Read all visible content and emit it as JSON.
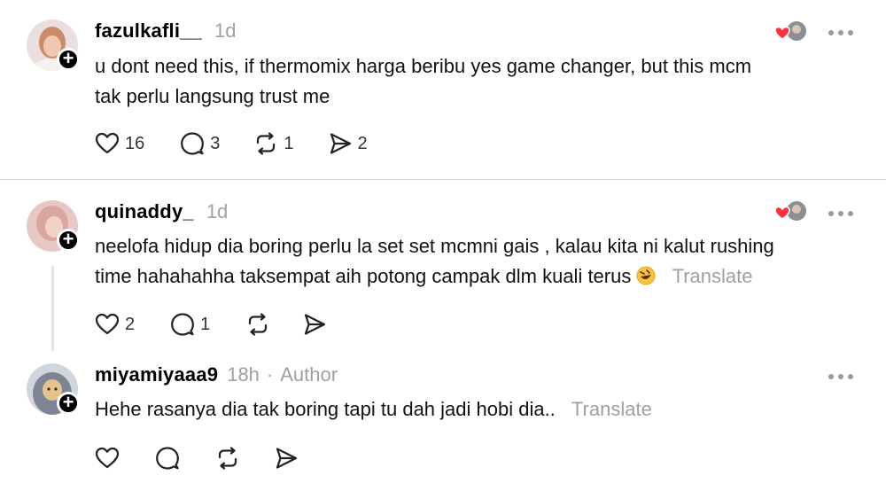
{
  "posts": [
    {
      "username": "fazulkafli__",
      "time": "1d",
      "text_lines": [
        "u dont need this, if thermomix harga beribu yes game changer, but this mcm",
        "tak perlu langsung trust me"
      ],
      "likes": "16",
      "replies": "3",
      "reposts": "1",
      "shares": "2"
    },
    {
      "username": "quinaddy_",
      "time": "1d",
      "text_lines": [
        "neelofa hidup dia boring perlu la set set mcmni gais , kalau kita ni kalut rushing",
        "time hahahahha taksempat aih potong campak dlm kuali terus"
      ],
      "translate": "Translate",
      "likes": "2",
      "replies": "1"
    },
    {
      "username": "miyamiyaaa9",
      "time": "18h",
      "separator": "·",
      "author_tag": "Author",
      "text": "Hehe rasanya dia tak boring tapi tu dah jadi hobi dia..",
      "translate": "Translate"
    }
  ],
  "icons": {
    "like": "heart-outline-icon",
    "reply": "speech-bubble-icon",
    "repost": "repost-icon",
    "share": "send-icon",
    "more": "more-dots-icon",
    "liked_by": "red-heart-avatar-icon",
    "emoji": "rofl-emoji-icon"
  },
  "colors": {
    "liked_heart": "#ff3040",
    "muted": "#a0a0a0"
  }
}
